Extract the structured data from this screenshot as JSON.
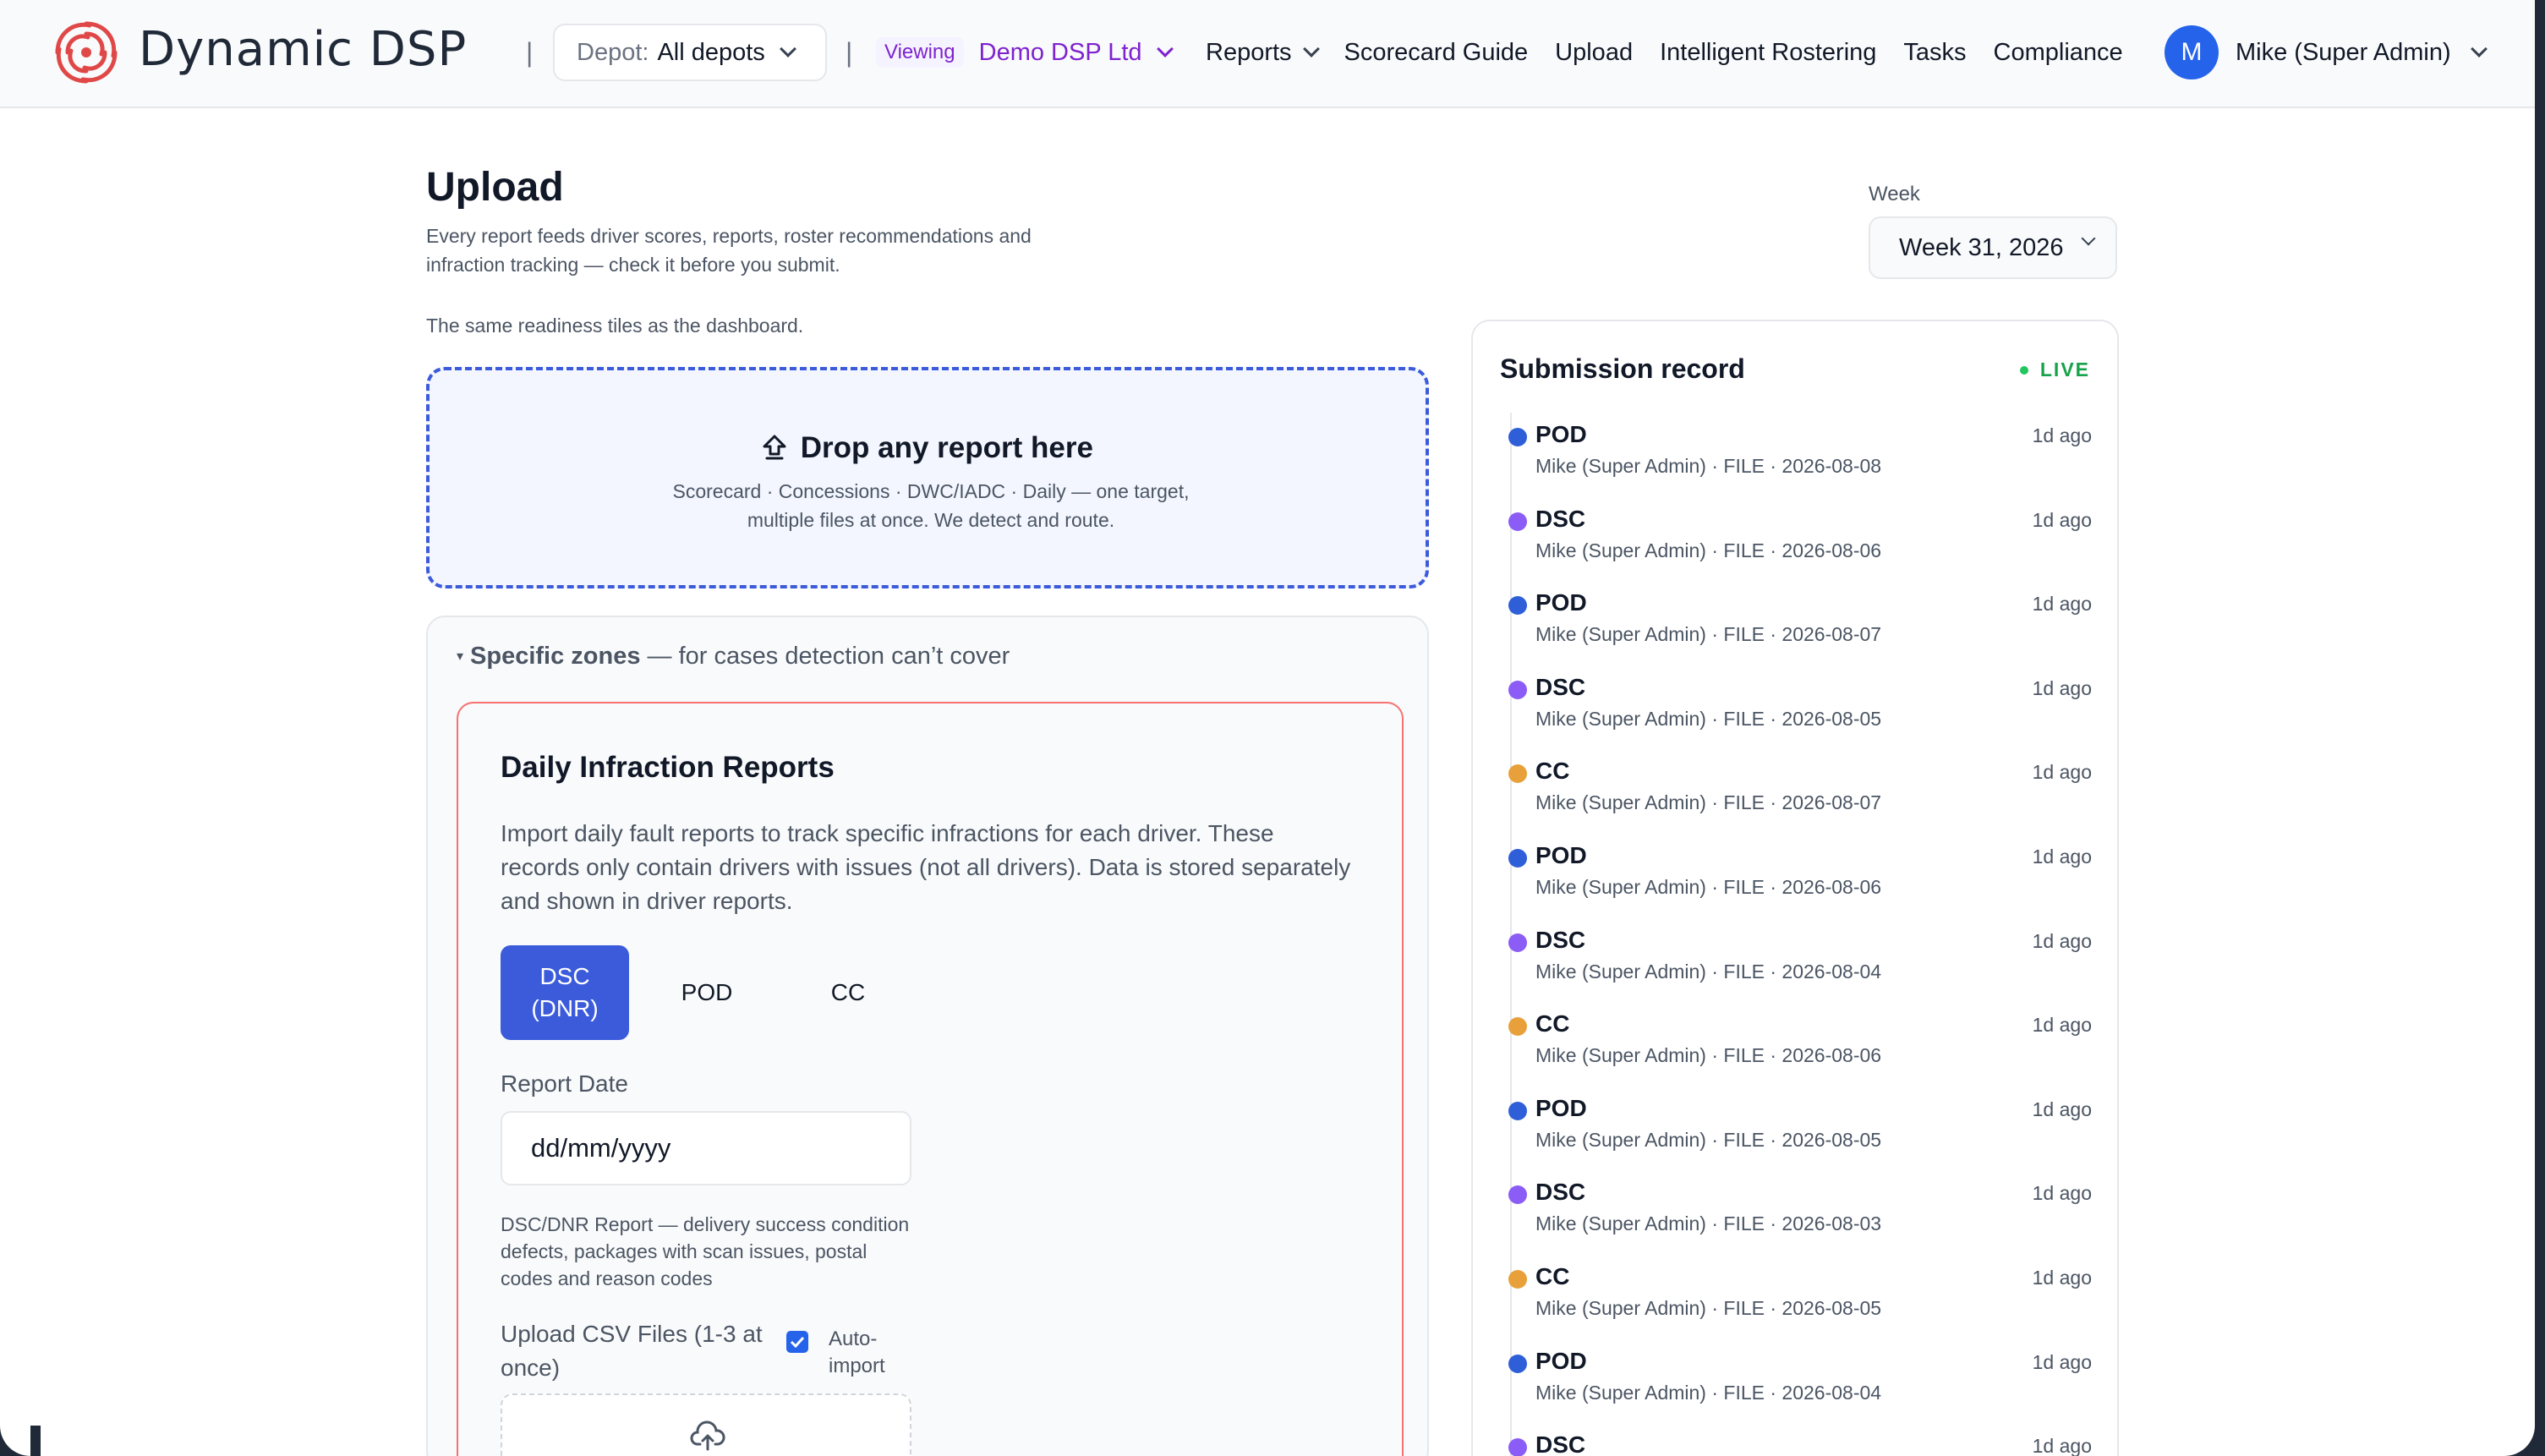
{
  "app": {
    "brand": "Dynamic DSP",
    "depot_label": "Depot:",
    "depot_value": "All depots",
    "viewing_label": "Viewing",
    "viewing_org": "Demo DSP Ltd",
    "nav": [
      "Reports",
      "Scorecard Guide",
      "Upload",
      "Intelligent Rostering",
      "Tasks",
      "Compliance"
    ],
    "user_initial": "M",
    "user_name": "Mike (Super Admin)"
  },
  "page": {
    "title": "Upload",
    "description": "Every report feeds driver scores, reports, roster recommendations and infraction tracking — check it before you submit.",
    "readiness_note": "The same readiness tiles as the dashboard.",
    "week_label": "Week",
    "week_value": "Week 31, 2026"
  },
  "dropzone": {
    "title": "Drop any report here",
    "subtitle": "Scorecard · Concessions · DWC/IADC · Daily — one target, multiple files at once. We detect and route."
  },
  "zones": {
    "heading": "Specific zones",
    "heading_suffix": " — for cases detection can’t cover",
    "card": {
      "title": "Daily Infraction Reports",
      "description": "Import daily fault reports to track specific infractions for each driver. These records only contain drivers with issues (not all drivers). Data is stored separately and shown in driver reports.",
      "tabs": [
        "DSC (DNR)",
        "POD",
        "CC"
      ],
      "active_tab": 0,
      "report_date_label": "Report Date",
      "report_date_placeholder": "dd/mm/yyyy",
      "help_text": "DSC/DNR Report — delivery success condition defects, packages with scan issues, postal codes and reason codes",
      "csv_label": "Upload CSV Files (1-3 at once)",
      "auto_import_label": "Auto-import",
      "auto_import_checked": true
    }
  },
  "submission_record": {
    "title": "Submission record",
    "live_label": "LIVE",
    "colors": {
      "POD": "#2f5fd8",
      "DSC": "#8b5cf6",
      "CC": "#e8a13a"
    },
    "items": [
      {
        "type": "POD",
        "meta": "Mike (Super Admin) · FILE · 2026-08-08",
        "time": "1d ago"
      },
      {
        "type": "DSC",
        "meta": "Mike (Super Admin) · FILE · 2026-08-06",
        "time": "1d ago"
      },
      {
        "type": "POD",
        "meta": "Mike (Super Admin) · FILE · 2026-08-07",
        "time": "1d ago"
      },
      {
        "type": "DSC",
        "meta": "Mike (Super Admin) · FILE · 2026-08-05",
        "time": "1d ago"
      },
      {
        "type": "CC",
        "meta": "Mike (Super Admin) · FILE · 2026-08-07",
        "time": "1d ago"
      },
      {
        "type": "POD",
        "meta": "Mike (Super Admin) · FILE · 2026-08-06",
        "time": "1d ago"
      },
      {
        "type": "DSC",
        "meta": "Mike (Super Admin) · FILE · 2026-08-04",
        "time": "1d ago"
      },
      {
        "type": "CC",
        "meta": "Mike (Super Admin) · FILE · 2026-08-06",
        "time": "1d ago"
      },
      {
        "type": "POD",
        "meta": "Mike (Super Admin) · FILE · 2026-08-05",
        "time": "1d ago"
      },
      {
        "type": "DSC",
        "meta": "Mike (Super Admin) · FILE · 2026-08-03",
        "time": "1d ago"
      },
      {
        "type": "CC",
        "meta": "Mike (Super Admin) · FILE · 2026-08-05",
        "time": "1d ago"
      },
      {
        "type": "POD",
        "meta": "Mike (Super Admin) · FILE · 2026-08-04",
        "time": "1d ago"
      },
      {
        "type": "DSC",
        "meta": "",
        "time": "1d ago"
      }
    ]
  }
}
